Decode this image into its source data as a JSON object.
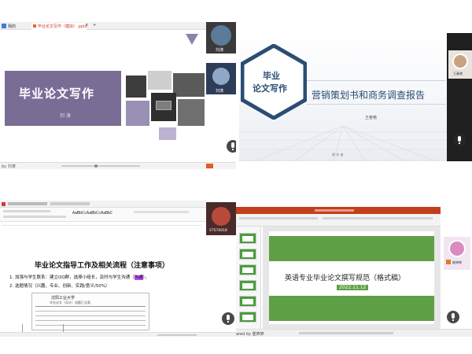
{
  "q1": {
    "tabs": [
      "我的",
      "毕业论文写作（模拟）.pptx"
    ],
    "slide_title": "毕业论文写作",
    "author": "刘 涛",
    "bottom_status": "by 刘涛",
    "participants": [
      {
        "name": "刘涛"
      },
      {
        "name": "刘涛"
      }
    ]
  },
  "q2": {
    "badge_line1": "毕业",
    "badge_line2": "论文写作",
    "slide_title": "营销策划书和商务调查报告",
    "author": "王春艳",
    "footer": "制 作 者",
    "participant_name": "王春艳"
  },
  "q3": {
    "doc_title": "毕业论文指导工作及相关流程（注意事项）",
    "item1": "1. 加强与学生联系：建立QQ群，选择小组长，及时与学生沟通（",
    "item1_highlight": "沟通",
    "item1_end": "）。",
    "item2": "2. 选题情况（兴趣、专业、创新、实践/意义/50%）",
    "style_preview": "AaBbCcAaBbCcAaBbC",
    "form_title": "毕业论文（设计）选题汇总表",
    "participant_name": "STS7001B"
  },
  "q4": {
    "slide_title": "英语专业毕业论文撰写规范（格式稿）",
    "slide_date": "2022.11.12",
    "bottom_status": "ared by 崔婷婷",
    "participant_name": "崔婷婷"
  }
}
